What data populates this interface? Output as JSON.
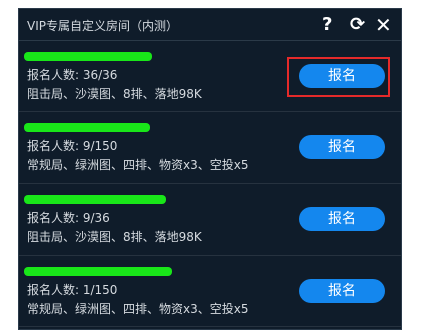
{
  "header": {
    "title": "VIP专属自定义房间（内测）",
    "help_icon": "?",
    "refresh_icon": "⟳",
    "close_icon": "✕"
  },
  "rooms": [
    {
      "count": "报名人数: 36/36",
      "mode": "阻击局、沙漠图、8排、落地98K",
      "button": "报名"
    },
    {
      "count": "报名人数: 9/150",
      "mode": "常规局、绿洲图、四排、物资x3、空投x5",
      "button": "报名"
    },
    {
      "count": "报名人数: 9/36",
      "mode": "阻击局、沙漠图、8排、落地98K",
      "button": "报名"
    },
    {
      "count": "报名人数: 1/150",
      "mode": "常规局、绿洲图、四排、物资x3、空投x5",
      "button": "报名"
    }
  ],
  "colors": {
    "panel_bg": "#0f1c2a",
    "button_bg": "#1487ee",
    "redaction": "#19e619",
    "highlight": "#e52a2a"
  }
}
